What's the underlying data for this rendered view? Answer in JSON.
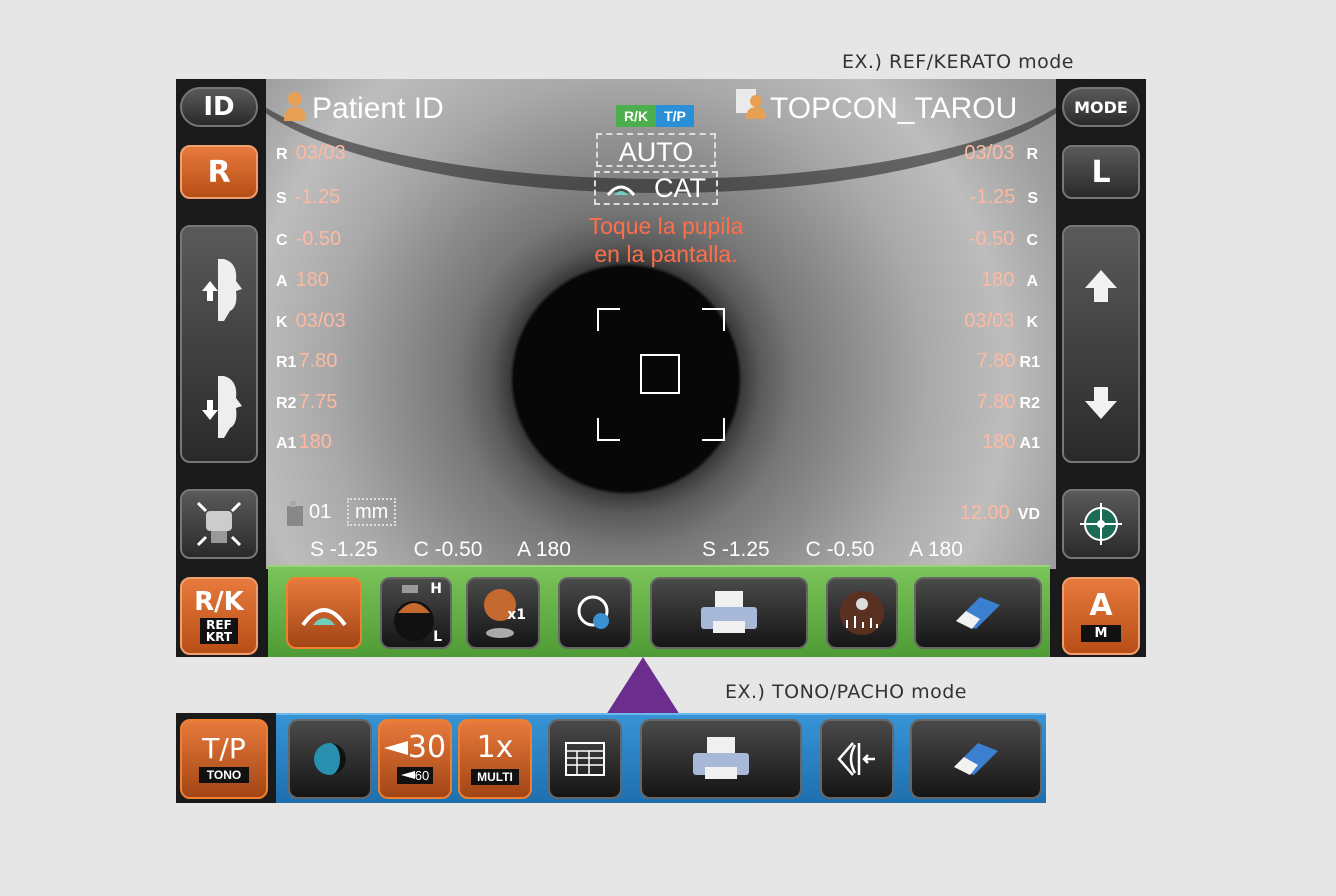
{
  "captions": {
    "top": "EX.) REF/KERATO mode",
    "bottom": "EX.) TONO/PACHO mode"
  },
  "header": {
    "id_button": "ID",
    "patient_label": "Patient ID",
    "badge_rk": "R/K",
    "badge_tp": "T/P",
    "operator_name": "TOPCON_TAROU",
    "mode_button": "MODE",
    "auto_label": "AUTO",
    "cat_label": "CAT",
    "message_line1": "Toque la pupila",
    "message_line2": "en la pantalla."
  },
  "left_buttons": {
    "eye_r": "R",
    "rk": "R/K",
    "rk_sub": "REF\nKRT"
  },
  "right_buttons": {
    "eye_l": "L",
    "am_top": "A",
    "am_bottom": "M"
  },
  "readings": {
    "right_eye": [
      {
        "key": "R",
        "value": "03/03"
      },
      {
        "key": "S",
        "value": "-1.25"
      },
      {
        "key": "C",
        "value": "-0.50"
      },
      {
        "key": "A",
        "value": "180"
      },
      {
        "key": "K",
        "value": "03/03"
      },
      {
        "key": "R1",
        "value": "7.80"
      },
      {
        "key": "R2",
        "value": "7.75"
      },
      {
        "key": "A1",
        "value": "180"
      }
    ],
    "left_eye": [
      {
        "key": "R",
        "value": "03/03"
      },
      {
        "key": "S",
        "value": "-1.25"
      },
      {
        "key": "C",
        "value": "-0.50"
      },
      {
        "key": "A",
        "value": "180"
      },
      {
        "key": "K",
        "value": "03/03"
      },
      {
        "key": "R1",
        "value": "7.80"
      },
      {
        "key": "R2",
        "value": "7.80"
      },
      {
        "key": "A1",
        "value": "180"
      }
    ],
    "count": "01",
    "unit": "mm",
    "vd_value": "12.00",
    "vd_key": "VD"
  },
  "summary_line": {
    "right": {
      "s_label": "S",
      "s": "-1.25",
      "c_label": "C",
      "c": "-0.50",
      "a_label": "A",
      "a": "180"
    },
    "left": {
      "s_label": "S",
      "s": "-1.25",
      "c_label": "C",
      "c": "-0.50",
      "a_label": "A",
      "a": "180"
    }
  },
  "ref_toolbar": {
    "chin_h": "H",
    "chin_l": "L",
    "multi_x1": "x1"
  },
  "tono_toolbar": {
    "tp_label": "T/P",
    "tp_sub": "TONO",
    "pressure_top": "30",
    "pressure_bottom": "60",
    "multi_top": "1x",
    "multi_bottom": "MULTI"
  },
  "colors": {
    "accent_orange": "#e0692a",
    "rk_green": "#4cae4c",
    "tp_blue": "#2a8fd6",
    "toolbar_green": "#6ab04c",
    "tono_blue": "#2e86c8",
    "arrow_purple": "#6b2d8e",
    "message_red": "#ff6e4a"
  }
}
